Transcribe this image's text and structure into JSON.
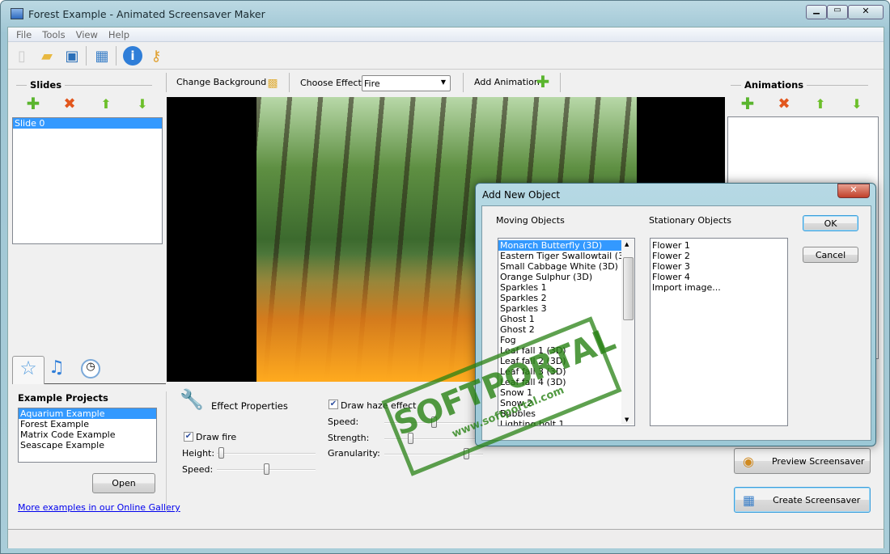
{
  "window": {
    "title": "Forest Example - Animated Screensaver Maker"
  },
  "menu": [
    "File",
    "Tools",
    "View",
    "Help"
  ],
  "toolbar_icons": [
    "new-icon",
    "open-folder-icon",
    "save-icon",
    "preview-monitor-icon",
    "info-icon",
    "key-icon"
  ],
  "slides": {
    "header": "Slides",
    "items": [
      "Slide 0"
    ],
    "selected": 0
  },
  "center_toolbar": {
    "change_background": "Change Background",
    "choose_effect_label": "Choose Effect:",
    "effect_value": "Fire",
    "add_animation": "Add Animation"
  },
  "animations": {
    "header": "Animations",
    "items": []
  },
  "left_tabs": [
    "star-icon",
    "music-icon",
    "clock-icon"
  ],
  "examples": {
    "header": "Example Projects",
    "items": [
      "Aquarium Example",
      "Forest Example",
      "Matrix Code Example",
      "Seascape Example"
    ],
    "selected": 0,
    "open": "Open",
    "gallery_link": "More examples in our Online Gallery"
  },
  "effect": {
    "title": "Effect Properties",
    "draw_fire": "Draw fire",
    "draw_fire_checked": true,
    "height_label": "Height:",
    "height_value": 0.02,
    "speed_label": "Speed:",
    "speed_value": 0.5,
    "draw_haze": "Draw haze effect",
    "draw_haze_checked": true,
    "haze_speed_label": "Speed:",
    "haze_speed_value": 0.5,
    "strength_label": "Strength:",
    "strength_value": 0.25,
    "granularity_label": "Granularity:",
    "granularity_value": 0.85
  },
  "buttons": {
    "preview": "Preview Screensaver",
    "create": "Create Screensaver"
  },
  "dialog": {
    "title": "Add New Object",
    "moving_label": "Moving Objects",
    "stationary_label": "Stationary Objects",
    "moving": [
      "Monarch Butterfly (3D)",
      "Eastern Tiger Swallowtail (3D)",
      "Small Cabbage White (3D)",
      "Orange Sulphur (3D)",
      "Sparkles 1",
      "Sparkles 2",
      "Sparkles 3",
      "Ghost 1",
      "Ghost 2",
      "Fog",
      "Leaf fall 1 (3D)",
      "Leaf fall 2 (3D)",
      "Leaf fall 3 (3D)",
      "Leaf fall 4 (3D)",
      "Snow 1",
      "Snow 2",
      "Bubbles",
      "Lighting bolt 1"
    ],
    "moving_selected": 0,
    "stationary": [
      "Flower 1",
      "Flower 2",
      "Flower 3",
      "Flower 4",
      "Import image..."
    ],
    "ok": "OK",
    "cancel": "Cancel"
  },
  "watermark": {
    "text": "SOFTPORTAL",
    "url": "www.softportal.com"
  }
}
